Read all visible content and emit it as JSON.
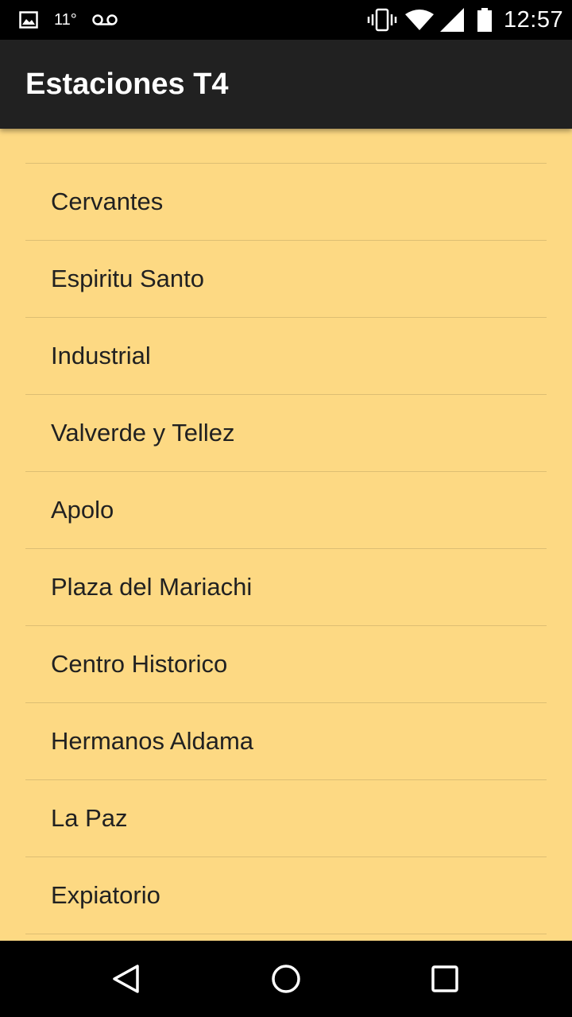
{
  "status_bar": {
    "temperature": "11°",
    "time": "12:57",
    "icons": [
      "image-icon",
      "voicemail-icon",
      "vibrate-icon",
      "wifi-icon",
      "signal-icon",
      "battery-icon"
    ]
  },
  "app_bar": {
    "title": "Estaciones T4",
    "background": "#212121"
  },
  "stations": [
    "Cervantes",
    "Espiritu Santo",
    "Industrial",
    "Valverde y Tellez",
    "Apolo",
    "Plaza del Mariachi",
    "Centro Historico",
    "Hermanos Aldama",
    "La Paz",
    "Expiatorio"
  ],
  "colors": {
    "list_background": "#FDD983",
    "divider": "#DDBE73",
    "text": "#212121"
  },
  "nav_bar": {
    "icons": [
      "back-icon",
      "home-icon",
      "recents-icon"
    ]
  }
}
